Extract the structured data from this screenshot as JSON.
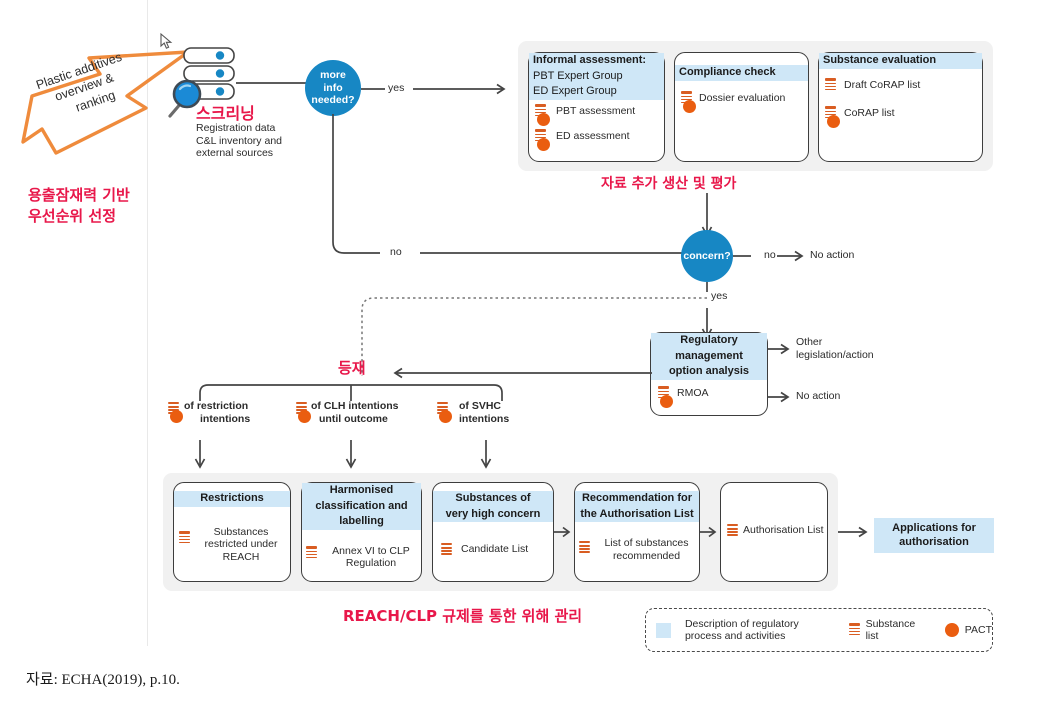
{
  "figure": {
    "source_caption": "자료: ECHA(2019), p.10."
  },
  "intro": {
    "big_arrow_text_line1": "Plastic additives",
    "big_arrow_text_line2": "overview &",
    "big_arrow_text_line3": "ranking",
    "arrow_color": "#ef8b3c",
    "korean_label_line1": "용출잠재력 기반",
    "korean_label_line2": "우선순위 선정"
  },
  "screening": {
    "icon": "database-magnifier-icon",
    "korean_title": "스크리닝",
    "desc_line1": "Registration data",
    "desc_line2": "C&L inventory and",
    "desc_line3": "external sources"
  },
  "decisions": {
    "more_info": {
      "label_line1": "more",
      "label_line2": "info",
      "label_line3": "needed?",
      "yes": "yes",
      "no": "no",
      "color": "#1787c4"
    },
    "concern": {
      "label": "concern?",
      "yes": "yes",
      "no": "no",
      "no_action": "No action",
      "color": "#1787c4"
    }
  },
  "assessment_group": {
    "korean_label": "자료 추가 생산 및 평가",
    "cards": [
      {
        "header": "Informal assessment:",
        "subheaders": [
          "PBT Expert Group",
          "ED Expert Group"
        ],
        "items": [
          {
            "label": "PBT assessment",
            "pact": true
          },
          {
            "label": "ED assessment",
            "pact": true
          }
        ]
      },
      {
        "header": "Compliance check",
        "subheaders": [],
        "items": [
          {
            "label": "Dossier evaluation",
            "pact": true
          }
        ]
      },
      {
        "header": "Substance evaluation",
        "subheaders": [],
        "items": [
          {
            "label": "Draft CoRAP list",
            "pact": false
          },
          {
            "label": "CoRAP list",
            "pact": true
          }
        ]
      }
    ]
  },
  "rmoa": {
    "header_line1": "Regulatory",
    "header_line2": "management",
    "header_line3": "option analysis",
    "item": "RMOA",
    "out_line1": "Other",
    "out_line2": "legislation/action",
    "out_no_action": "No action"
  },
  "intentions": {
    "korean_label": "등재",
    "items": [
      {
        "line1": "of restriction",
        "line2": "intentions"
      },
      {
        "line1": "of CLH intentions",
        "line2": "until outcome"
      },
      {
        "line1": "of SVHC",
        "line2": "intentions"
      }
    ]
  },
  "regulatory_row": {
    "korean_label": "REACH/CLP 규제를 통한 위해 관리",
    "cards": [
      {
        "header_lines": [
          "Restrictions"
        ],
        "item_lines": [
          "Substances",
          "restricted under",
          "REACH"
        ]
      },
      {
        "header_lines": [
          "Harmonised",
          "classification and",
          "labelling"
        ],
        "item_lines": [
          "Annex VI to CLP",
          "Regulation"
        ]
      },
      {
        "header_lines": [
          "Substances of",
          "very high concern"
        ],
        "item_lines": [
          "Candidate List"
        ]
      },
      {
        "header_lines": [
          "Recommendation for",
          "the Authorisation List"
        ],
        "item_lines": [
          "List of substances",
          "recommended"
        ]
      },
      {
        "header_lines": [],
        "item_lines": [
          "Authorisation List"
        ]
      }
    ],
    "final_box_line1": "Applications for",
    "final_box_line2": "authorisation"
  },
  "legend": {
    "process_line1": "Description of regulatory",
    "process_line2": "process and activities",
    "substance_list": "Substance list",
    "pact": "PACT",
    "swatch_color": "#cfe7f7",
    "pact_color": "#ea5d10"
  }
}
